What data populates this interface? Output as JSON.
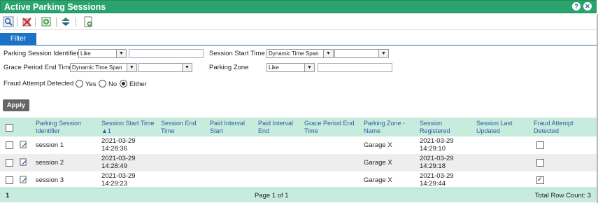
{
  "title": "Active Parking Sessions",
  "header_icons": [
    "help-icon",
    "close-icon"
  ],
  "toolbar_icons": [
    "view-icon",
    "delete-icon",
    "add-icon",
    "transfer-icon",
    "export-icon"
  ],
  "filter": {
    "tab_label": "Filter",
    "psi_label": "Parking Session Identifier",
    "psi_op": "Like",
    "psi_value": "",
    "sst_label": "Session Start Time",
    "sst_op": "Dynamic Time Span",
    "sst_value": "",
    "gpe_label": "Grace Period End Time",
    "gpe_op": "Dynamic Time Span",
    "gpe_value": "",
    "pz_label": "Parking Zone",
    "pz_op": "Like",
    "pz_value": "",
    "fraud_label": "Fraud Attempt Detected",
    "fraud_yes": "Yes",
    "fraud_no": "No",
    "fraud_either": "Either",
    "fraud_selected": "Either",
    "apply_label": "Apply"
  },
  "table": {
    "headers": [
      "Parking Session\nIdentifier",
      "Session Start Time\n▲1",
      "Session End\nTime",
      "Paid Interval\nStart",
      "Paid Interval\nEnd",
      "Grace Period End\nTime",
      "Parking Zone -\nName",
      "Session\nRegistered",
      "Session Last\nUpdated",
      "Fraud Attempt\nDetected"
    ],
    "rows": [
      {
        "id": "session 1",
        "start": "2021-03-29\n14:28:36",
        "zone": "Garage X",
        "registered": "2021-03-29\n14:29:10",
        "fraud": false
      },
      {
        "id": "session 2",
        "start": "2021-03-29\n14:28:49",
        "zone": "Garage X",
        "registered": "2021-03-29\n14:29:18",
        "fraud": false
      },
      {
        "id": "session 3",
        "start": "2021-03-29\n14:29:23",
        "zone": "Garage X",
        "registered": "2021-03-29\n14:29:44",
        "fraud": true
      }
    ]
  },
  "footer": {
    "page_number": "1",
    "page_info": "Page 1 of 1",
    "total": "Total Row Count: 3"
  }
}
